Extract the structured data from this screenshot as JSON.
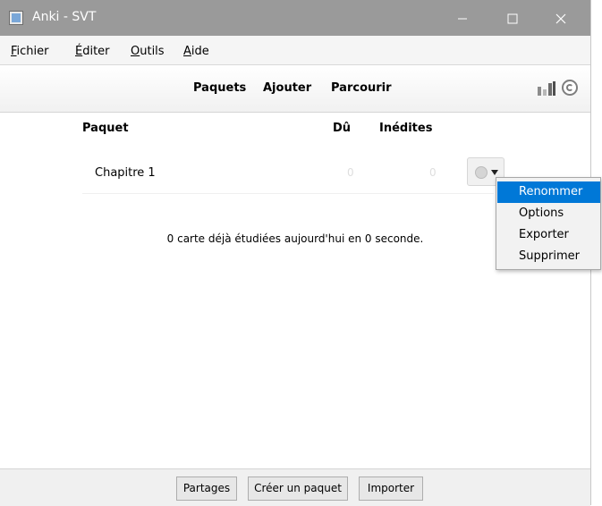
{
  "window": {
    "title": "Anki - SVT"
  },
  "menu": {
    "items": [
      {
        "label": "Fichier",
        "accel": "F",
        "rest": "ichier"
      },
      {
        "label": "Éditer",
        "accel": "É",
        "rest": "diter"
      },
      {
        "label": "Outils",
        "accel": "O",
        "rest": "utils"
      },
      {
        "label": "Aide",
        "accel": "A",
        "rest": "ide"
      }
    ]
  },
  "toolbar": {
    "links": [
      "Paquets",
      "Ajouter",
      "Parcourir"
    ],
    "icons": [
      "stats-icon",
      "sync-icon"
    ]
  },
  "deck_list": {
    "headers": {
      "deck": "Paquet",
      "due": "Dû",
      "new": "Inédites"
    },
    "rows": [
      {
        "name": "Chapitre 1",
        "due": "0",
        "new": "0"
      }
    ],
    "studied_text": "0 carte déjà étudiées aujourd'hui en 0 seconde."
  },
  "context_menu": {
    "items": [
      "Renommer",
      "Options",
      "Exporter",
      "Supprimer"
    ],
    "selected_index": 0
  },
  "bottom_buttons": [
    "Partages",
    "Créer un paquet",
    "Importer"
  ],
  "colors": {
    "titlebar": "#9a9a9a",
    "selection": "#0078d7",
    "muted_numbers": "#dedede"
  }
}
